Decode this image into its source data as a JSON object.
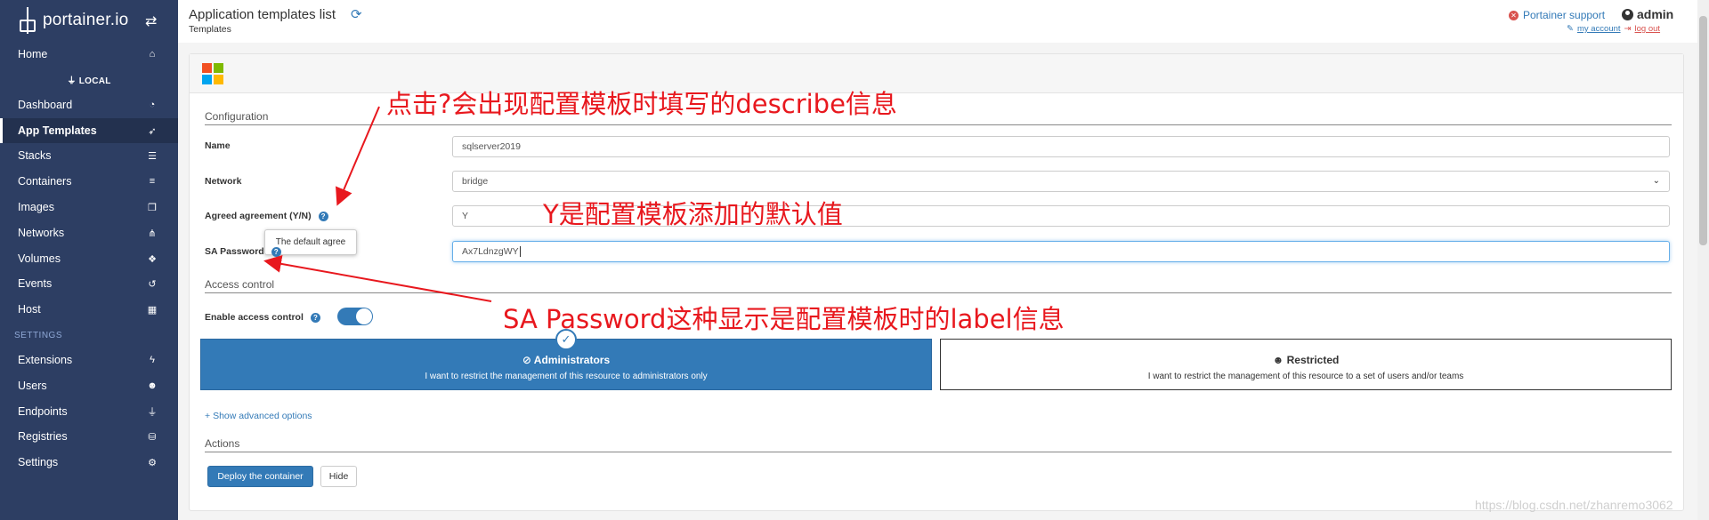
{
  "brand": {
    "name": "portainer.io"
  },
  "sidebar": {
    "local_label": "LOCAL",
    "settings_label": "SETTINGS",
    "items": [
      {
        "label": "Home",
        "icon": "home-icon",
        "glyph": "⌂"
      },
      {
        "label": "Dashboard",
        "icon": "dashboard-icon",
        "glyph": "◔"
      },
      {
        "label": "App Templates",
        "icon": "rocket-icon",
        "glyph": "➶"
      },
      {
        "label": "Stacks",
        "icon": "th-list-icon",
        "glyph": "☰"
      },
      {
        "label": "Containers",
        "icon": "server-icon",
        "glyph": "≡"
      },
      {
        "label": "Images",
        "icon": "clone-icon",
        "glyph": "❐"
      },
      {
        "label": "Networks",
        "icon": "sitemap-icon",
        "glyph": "⋔"
      },
      {
        "label": "Volumes",
        "icon": "cubes-icon",
        "glyph": "❖"
      },
      {
        "label": "Events",
        "icon": "history-icon",
        "glyph": "↺"
      },
      {
        "label": "Host",
        "icon": "th-icon",
        "glyph": "▦"
      },
      {
        "label": "Extensions",
        "icon": "bolt-icon",
        "glyph": "ϟ"
      },
      {
        "label": "Users",
        "icon": "users-icon",
        "glyph": "☻"
      },
      {
        "label": "Endpoints",
        "icon": "plug-icon",
        "glyph": "⏚"
      },
      {
        "label": "Registries",
        "icon": "database-icon",
        "glyph": "⛁"
      },
      {
        "label": "Settings",
        "icon": "cogs-icon",
        "glyph": "⚙"
      }
    ]
  },
  "header": {
    "title": "Application templates list",
    "breadcrumb": "Templates",
    "support_label": "Portainer support",
    "username": "admin",
    "my_account": "my account",
    "logout": "log out"
  },
  "configuration": {
    "section_title": "Configuration",
    "name_label": "Name",
    "name_value": "sqlserver2019",
    "network_label": "Network",
    "network_value": "bridge",
    "agree_label": "Agreed agreement (Y/N)",
    "agree_value": "Y",
    "tooltip_text": "The default agree",
    "password_label": "SA Password",
    "password_value": "Ax7LdnzgWY"
  },
  "access_control": {
    "section_title": "Access control",
    "enable_label": "Enable access control",
    "enabled": true,
    "admin_title": "Administrators",
    "admin_desc": "I want to restrict the management of this resource to administrators only",
    "restricted_title": "Restricted",
    "restricted_desc": "I want to restrict the management of this resource to a set of users and/or teams",
    "advanced_link": "Show advanced options"
  },
  "actions": {
    "section_title": "Actions",
    "deploy_label": "Deploy the container",
    "hide_label": "Hide"
  },
  "annotations": {
    "top": "点击?会出现配置模板时填写的describe信息",
    "middle": "Y是配置模板添加的默认值",
    "bottom": "SA Password这种显示是配置模板时的label信息",
    "color": "#e8181e"
  },
  "watermark": "https://blog.csdn.net/zhanremo3062",
  "colors": {
    "sidebar": "#2d3e63",
    "primary": "#337ab7",
    "ms_red": "#f25022",
    "ms_green": "#7fba00",
    "ms_blue": "#00a4ef",
    "ms_yellow": "#ffb900"
  }
}
